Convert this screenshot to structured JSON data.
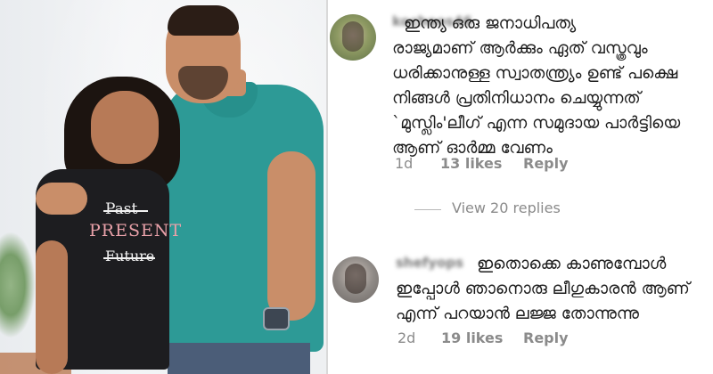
{
  "photo": {
    "shirt_lines": [
      "Past",
      "PRESENT",
      "Future"
    ]
  },
  "comments": [
    {
      "username": "kochoos46",
      "text_lines": [
        "ഇന്ത്യ ഒരു ജനാധിപത്യ",
        "രാജ്യമാണ് ആർക്കും ഏത് വസ്ത്രവും",
        "ധരിക്കാനുള്ള സ്വാതന്ത്ര്യം ഉണ്ട് പക്ഷെ",
        "നിങ്ങൾ പ്രതിനിധാനം ചെയ്യുന്നത്",
        "`മുസ്ലിം'ലീഗ് എന്ന സമുദായ പാർട്ടിയെ",
        "ആണ് ഓർമ്മ വേണം"
      ],
      "time": "1d",
      "likes": "13 likes",
      "reply": "Reply",
      "view_replies": "View 20 replies"
    },
    {
      "username": "shefyops",
      "text_lines": [
        "ഇതൊക്കെ കാണുമ്പോൾ",
        "ഇപ്പോൾ ഞാനൊരു ലീഗുകാരൻ ആണ്",
        "എന്ന് പറയാൻ ലജ്ജ തോന്നുന്നു"
      ],
      "time": "2d",
      "likes": "19 likes",
      "reply": "Reply"
    }
  ],
  "colors": {
    "meta_gray": "#8b8b8b",
    "text_dark": "#1e1e1e",
    "shirt_teal": "#2d9a96"
  }
}
